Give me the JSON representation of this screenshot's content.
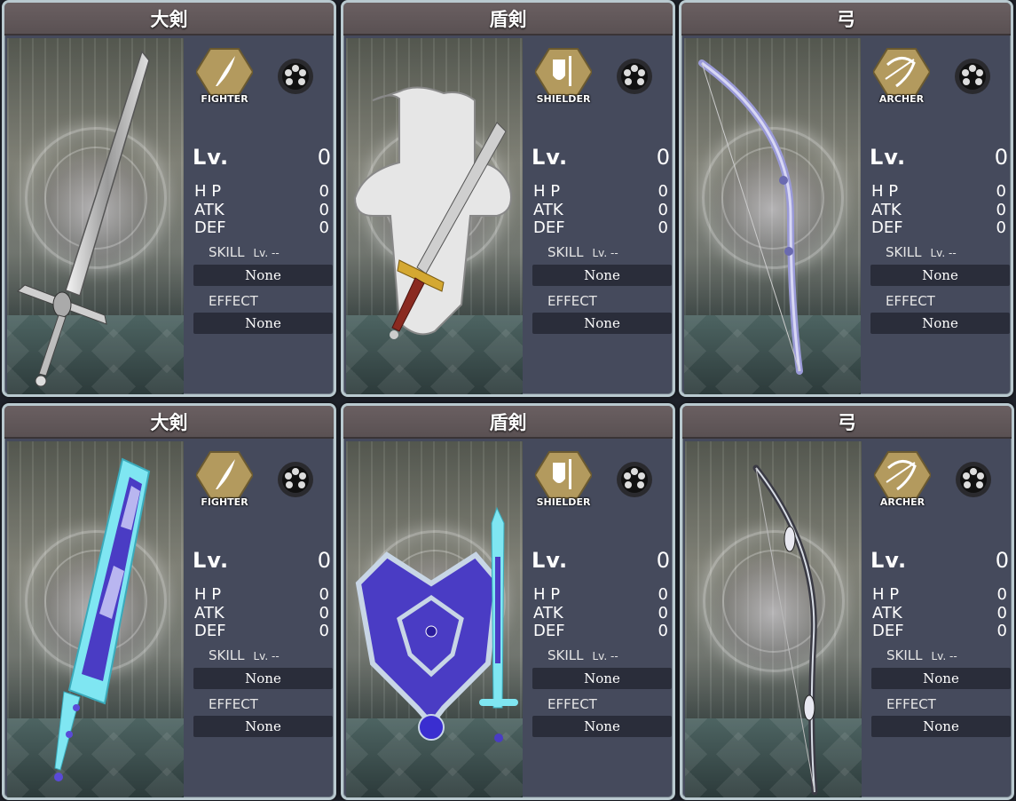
{
  "cards": [
    {
      "title": "大剣",
      "class_label": "FIGHTER",
      "class_icon": "quill-icon",
      "lv_label": "Lv.",
      "lv": "0",
      "hp_label": "H P",
      "hp": "0",
      "atk_label": "ATK",
      "atk": "0",
      "def_label": "DEF",
      "def": "0",
      "skill_label": "SKILL",
      "skill_lv": "Lv. --",
      "skill": "None",
      "effect_label": "EFFECT",
      "effect": "None",
      "weapon": "greatsword-silver"
    },
    {
      "title": "盾剣",
      "class_label": "SHIELDER",
      "class_icon": "shield-sword-icon",
      "lv_label": "Lv.",
      "lv": "0",
      "hp_label": "H P",
      "hp": "0",
      "atk_label": "ATK",
      "atk": "0",
      "def_label": "DEF",
      "def": "0",
      "skill_label": "SKILL",
      "skill_lv": "Lv. --",
      "skill": "None",
      "effect_label": "EFFECT",
      "effect": "None",
      "weapon": "shield-sword-silver"
    },
    {
      "title": "弓",
      "class_label": "ARCHER",
      "class_icon": "bow-icon",
      "lv_label": "Lv.",
      "lv": "0",
      "hp_label": "H P",
      "hp": "0",
      "atk_label": "ATK",
      "atk": "0",
      "def_label": "DEF",
      "def": "0",
      "skill_label": "SKILL",
      "skill_lv": "Lv. --",
      "skill": "None",
      "effect_label": "EFFECT",
      "effect": "None",
      "weapon": "bow-lavender"
    },
    {
      "title": "大剣",
      "class_label": "FIGHTER",
      "class_icon": "quill-icon",
      "lv_label": "Lv.",
      "lv": "0",
      "hp_label": "H P",
      "hp": "0",
      "atk_label": "ATK",
      "atk": "0",
      "def_label": "DEF",
      "def": "0",
      "skill_label": "SKILL",
      "skill_lv": "Lv. --",
      "skill": "None",
      "effect_label": "EFFECT",
      "effect": "None",
      "weapon": "greatsword-crystal"
    },
    {
      "title": "盾剣",
      "class_label": "SHIELDER",
      "class_icon": "shield-sword-icon",
      "lv_label": "Lv.",
      "lv": "0",
      "hp_label": "H P",
      "hp": "0",
      "atk_label": "ATK",
      "atk": "0",
      "def_label": "DEF",
      "def": "0",
      "skill_label": "SKILL",
      "skill_lv": "Lv. --",
      "skill": "None",
      "effect_label": "EFFECT",
      "effect": "None",
      "weapon": "shield-sword-crystal"
    },
    {
      "title": "弓",
      "class_label": "ARCHER",
      "class_icon": "bow-icon",
      "lv_label": "Lv.",
      "lv": "0",
      "hp_label": "H P",
      "hp": "0",
      "atk_label": "ATK",
      "atk": "0",
      "def_label": "DEF",
      "def": "0",
      "skill_label": "SKILL",
      "skill_lv": "Lv. --",
      "skill": "None",
      "effect_label": "EFFECT",
      "effect": "None",
      "weapon": "bow-dark"
    }
  ],
  "colors": {
    "panel": "#454a5c",
    "title_bar": "#5f5658",
    "border": "#b9c9cf",
    "value_box": "#2a2d3a",
    "badge_gold": "#b39a5e"
  }
}
